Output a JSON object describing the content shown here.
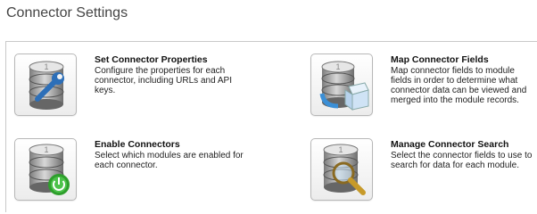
{
  "page": {
    "title": "Connector Settings"
  },
  "items": [
    {
      "title": "Set Connector Properties",
      "description": "Configure the properties for each connector, including URLs and API keys.",
      "icon": "database-wrench-icon"
    },
    {
      "title": "Map Connector Fields",
      "description": "Map connector fields to module fields in order to determine what connector data can be viewed and merged into the module records.",
      "icon": "database-cube-icon"
    },
    {
      "title": "Enable Connectors",
      "description": "Select which modules are enabled for each connector.",
      "icon": "database-power-icon"
    },
    {
      "title": "Manage Connector Search",
      "description": "Select the connector fields to use to search for data for each module.",
      "icon": "database-magnifier-icon"
    }
  ],
  "colors": {
    "power_green": "#4cc24a",
    "cube_blue": "#3b8fd6",
    "magnifier_gold": "#c79a2a"
  }
}
